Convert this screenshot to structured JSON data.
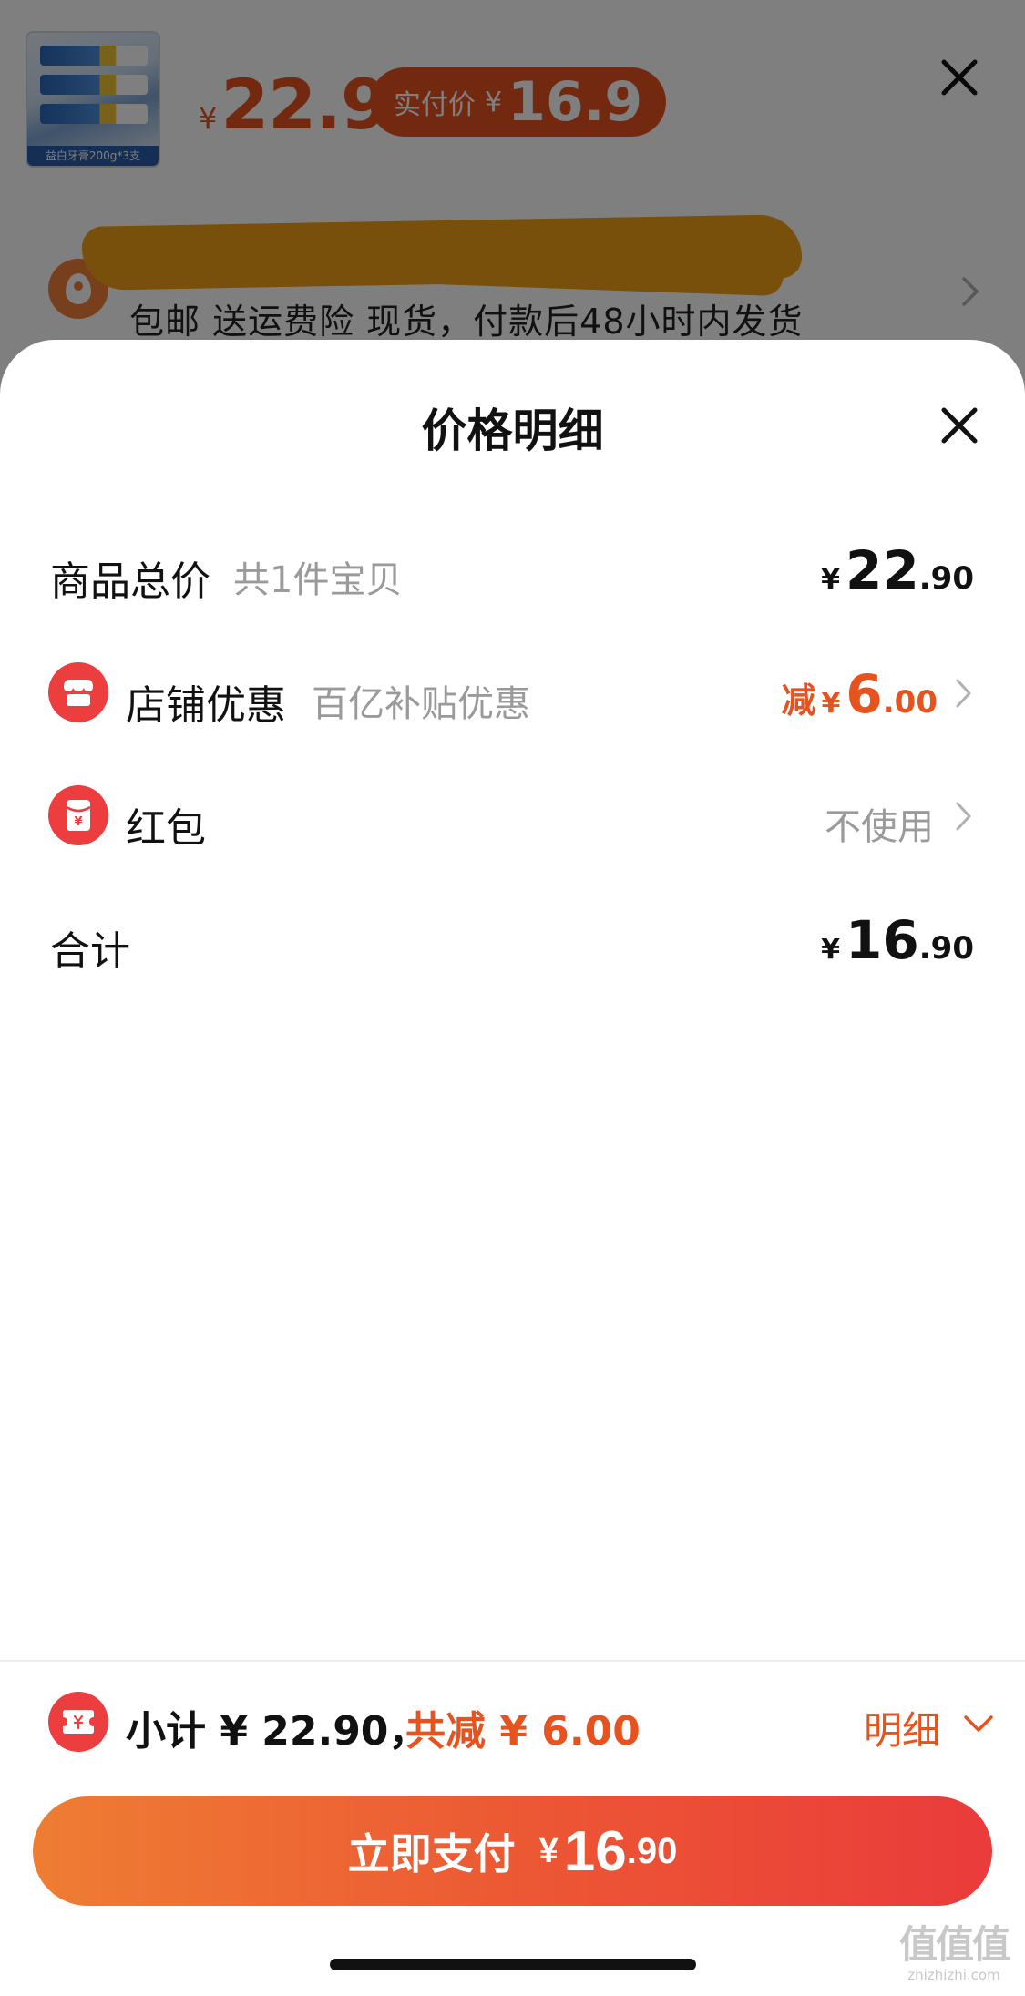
{
  "background": {
    "product_caption": "益白牙膏200g*3支",
    "original_price": {
      "yen": "¥",
      "amount": "22.9"
    },
    "actual_pay": {
      "label": "实付价",
      "yen": "¥",
      "amount": "16.9"
    },
    "shipping_info": "包邮  送运费险  现货，付款后48小时内发货"
  },
  "sheet": {
    "title": "价格明细",
    "rows": {
      "goods_total": {
        "label": "商品总价",
        "sub": "共1件宝贝",
        "yen": "¥",
        "int": "22",
        "dec": ".90"
      },
      "shop_discount": {
        "label": "店铺优惠",
        "sub": "百亿补贴优惠",
        "prefix": "减",
        "yen": "¥",
        "int": "6",
        "dec": ".00"
      },
      "red_packet": {
        "label": "红包",
        "value": "不使用"
      },
      "total": {
        "label": "合计",
        "yen": "¥",
        "int": "16",
        "dec": ".90"
      }
    }
  },
  "bottom": {
    "subtotal_text": "小计 ¥ 22.90，",
    "saved_text": "共减 ¥ 6.00",
    "detail_label": "明细",
    "pay_button": {
      "label": "立即支付",
      "yen": "¥",
      "int": "16",
      "dec": ".90"
    }
  },
  "watermark": {
    "mark": "值值值",
    "url": "zhizhizhi.com"
  },
  "colors": {
    "accent": "#e7531f",
    "icon_red": "#ec3e3e",
    "button_start": "#ef7d33",
    "button_end": "#ea3b3b"
  },
  "icons": [
    "close-icon",
    "location-pin-icon",
    "chevron-right-icon",
    "shop-icon",
    "red-packet-icon",
    "coupon-icon",
    "chevron-down-icon"
  ]
}
